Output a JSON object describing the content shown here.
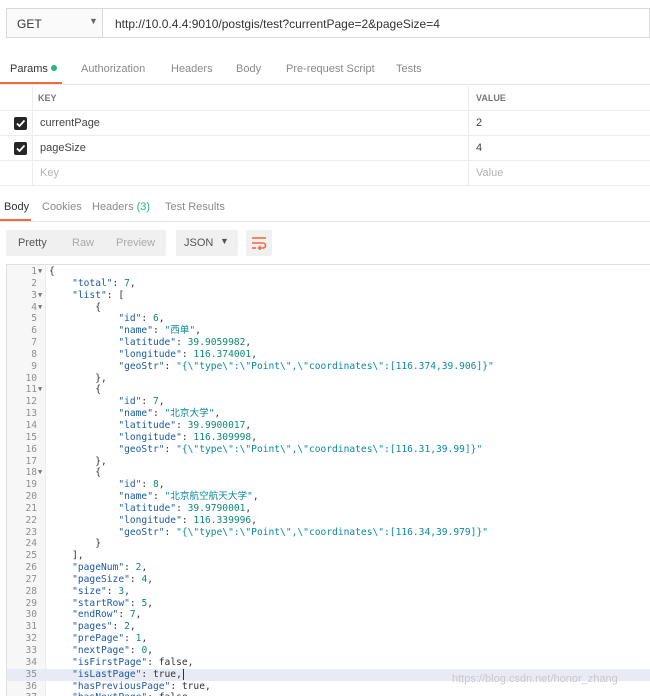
{
  "request": {
    "method": "GET",
    "url": "http://10.0.4.4:9010/postgis/test?currentPage=2&pageSize=4"
  },
  "request_tabs": [
    "Params",
    "Authorization",
    "Headers",
    "Body",
    "Pre-request Script",
    "Tests"
  ],
  "params": {
    "header_key": "KEY",
    "header_value": "VALUE",
    "rows": [
      {
        "key": "currentPage",
        "value": "2",
        "checked": true
      },
      {
        "key": "pageSize",
        "value": "4",
        "checked": true
      }
    ],
    "placeholder_key": "Key",
    "placeholder_value": "Value"
  },
  "response_tabs": {
    "body": "Body",
    "cookies": "Cookies",
    "headers": "Headers",
    "headers_count": "(3)",
    "tests": "Test Results"
  },
  "view_modes": [
    "Pretty",
    "Raw",
    "Preview"
  ],
  "format": "JSON",
  "code_lines": [
    "{",
    "    \"total\": 7,",
    "    \"list\": [",
    "        {",
    "            \"id\": 6,",
    "            \"name\": \"西单\",",
    "            \"latitude\": 39.9059982,",
    "            \"longitude\": 116.374001,",
    "            \"geoStr\": \"{\\\"type\\\":\\\"Point\\\",\\\"coordinates\\\":[116.374,39.906]}\"",
    "        },",
    "        {",
    "            \"id\": 7,",
    "            \"name\": \"北京大学\",",
    "            \"latitude\": 39.9900017,",
    "            \"longitude\": 116.309998,",
    "            \"geoStr\": \"{\\\"type\\\":\\\"Point\\\",\\\"coordinates\\\":[116.31,39.99]}\"",
    "        },",
    "        {",
    "            \"id\": 8,",
    "            \"name\": \"北京航空航天大学\",",
    "            \"latitude\": 39.9790001,",
    "            \"longitude\": 116.339996,",
    "            \"geoStr\": \"{\\\"type\\\":\\\"Point\\\",\\\"coordinates\\\":[116.34,39.979]}\"",
    "        }",
    "    ],",
    "    \"pageNum\": 2,",
    "    \"pageSize\": 4,",
    "    \"size\": 3,",
    "    \"startRow\": 5,",
    "    \"endRow\": 7,",
    "    \"pages\": 2,",
    "    \"prePage\": 1,",
    "    \"nextPage\": 0,",
    "    \"isFirstPage\": false,",
    "    \"isLastPage\": true,",
    "    \"hasPreviousPage\": true,",
    "    \"hasNextPage\": false,"
  ],
  "fold_lines": [
    1,
    3,
    4,
    11,
    18
  ],
  "current_line": 35,
  "watermark": "https://blog.csdn.net/honor_zhang",
  "colors": {
    "accent": "#f26b3a",
    "green": "#26b47f"
  }
}
